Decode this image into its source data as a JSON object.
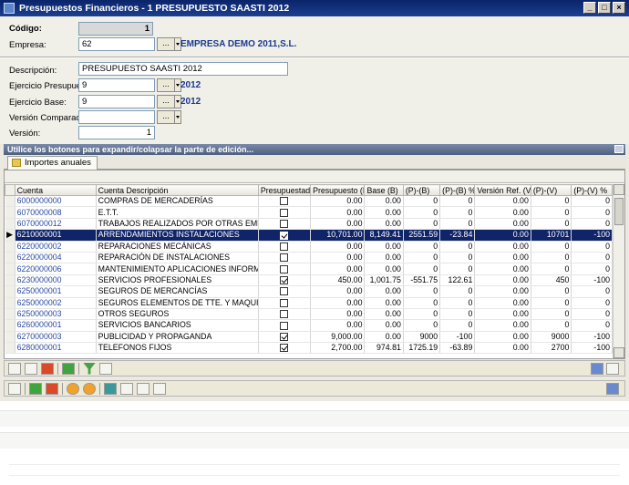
{
  "window": {
    "title": "Presupuestos Financieros - 1  PRESUPUESTO SAASTI 2012",
    "btn_min": "_",
    "btn_max": "□",
    "btn_close": "×"
  },
  "form": {
    "codigo_label": "Código:",
    "codigo_value": "1",
    "empresa_label": "Empresa:",
    "empresa_value": "62",
    "empresa_name": "EMPRESA DEMO 2011,S.L.",
    "descripcion_label": "Descripción:",
    "descripcion_value": "PRESUPUESTO SAASTI 2012",
    "ejercicio_presupuesto_label": "Ejercicio Presupuesto:",
    "ejercicio_presupuesto_value": "9",
    "ejercicio_presupuesto_year": "2012",
    "ejercicio_base_label": "Ejercicio Base:",
    "ejercicio_base_value": "9",
    "ejercicio_base_year": "2012",
    "version_comparacion_label": "Versión Comparación:",
    "version_comparacion_value": "",
    "version_label": "Versión:",
    "version_value": "1",
    "lookup_label": "..."
  },
  "collapse_bar": {
    "text": "Utilice los botones para expandir/colapsar la parte de edición..."
  },
  "tabs": [
    {
      "label": "Importes anuales"
    }
  ],
  "grid": {
    "columns": [
      "Cuenta",
      "Cuenta Descripción",
      "Presupuestada",
      "Presupuesto (P)",
      "Base (B)",
      "(P)-(B)",
      "(P)-(B) %",
      "Versión Ref. (V)",
      "(P)-(V)",
      "(P)-(V) %"
    ],
    "rows": [
      {
        "cuenta": "6000000000",
        "desc": "COMPRAS DE MERCADERÍAS",
        "pres": false,
        "p": "0.00",
        "b": "0.00",
        "pb": "0",
        "pbp": "0",
        "v": "0.00",
        "pv": "0",
        "pvp": "0"
      },
      {
        "cuenta": "6070000008",
        "desc": "E.T.T.",
        "pres": false,
        "p": "0.00",
        "b": "0.00",
        "pb": "0",
        "pbp": "0",
        "v": "0.00",
        "pv": "0",
        "pvp": "0"
      },
      {
        "cuenta": "6070000012",
        "desc": "TRABAJOS REALIZADOS POR OTRAS EMPRESA",
        "pres": false,
        "p": "0.00",
        "b": "0.00",
        "pb": "0",
        "pbp": "0",
        "v": "0.00",
        "pv": "0",
        "pvp": "0"
      },
      {
        "cuenta": "6210000001",
        "desc": "ARRENDAMIENTOS INSTALACIONES",
        "pres": true,
        "p": "10,701.00",
        "b": "8,149.41",
        "pb": "2551.59",
        "pbp": "-23.84",
        "v": "0.00",
        "pv": "10701",
        "pvp": "-100",
        "selected": true
      },
      {
        "cuenta": "6220000002",
        "desc": "REPARACIONES MECÁNICAS",
        "pres": false,
        "p": "0.00",
        "b": "0.00",
        "pb": "0",
        "pbp": "0",
        "v": "0.00",
        "pv": "0",
        "pvp": "0"
      },
      {
        "cuenta": "6220000004",
        "desc": "REPARACIÓN DE INSTALACIONES",
        "pres": false,
        "p": "0.00",
        "b": "0.00",
        "pb": "0",
        "pbp": "0",
        "v": "0.00",
        "pv": "0",
        "pvp": "0"
      },
      {
        "cuenta": "6220000006",
        "desc": "MANTENIMIENTO APLICACIONES INFORMÁTICA",
        "pres": false,
        "p": "0.00",
        "b": "0.00",
        "pb": "0",
        "pbp": "0",
        "v": "0.00",
        "pv": "0",
        "pvp": "0"
      },
      {
        "cuenta": "6230000000",
        "desc": "SERVICIOS PROFESIONALES",
        "pres": true,
        "p": "450.00",
        "b": "1,001.75",
        "pb": "-551.75",
        "pbp": "122.61",
        "v": "0.00",
        "pv": "450",
        "pvp": "-100"
      },
      {
        "cuenta": "6250000001",
        "desc": "SEGUROS DE MERCANCÍAS",
        "pres": false,
        "p": "0.00",
        "b": "0.00",
        "pb": "0",
        "pbp": "0",
        "v": "0.00",
        "pv": "0",
        "pvp": "0"
      },
      {
        "cuenta": "6250000002",
        "desc": "SEGUROS ELEMENTOS DE TTE. Y MAQUINARI",
        "pres": false,
        "p": "0.00",
        "b": "0.00",
        "pb": "0",
        "pbp": "0",
        "v": "0.00",
        "pv": "0",
        "pvp": "0"
      },
      {
        "cuenta": "6250000003",
        "desc": "OTROS SEGUROS",
        "pres": false,
        "p": "0.00",
        "b": "0.00",
        "pb": "0",
        "pbp": "0",
        "v": "0.00",
        "pv": "0",
        "pvp": "0"
      },
      {
        "cuenta": "6260000001",
        "desc": "SERVICIOS BANCARIOS",
        "pres": false,
        "p": "0.00",
        "b": "0.00",
        "pb": "0",
        "pbp": "0",
        "v": "0.00",
        "pv": "0",
        "pvp": "0"
      },
      {
        "cuenta": "6270000003",
        "desc": "PUBLICIDAD Y PROPAGANDA",
        "pres": true,
        "p": "9,000.00",
        "b": "0.00",
        "pb": "9000",
        "pbp": "-100",
        "v": "0.00",
        "pv": "9000",
        "pvp": "-100"
      },
      {
        "cuenta": "6280000001",
        "desc": "TELEFONOS FIJOS",
        "pres": true,
        "p": "2,700.00",
        "b": "974.81",
        "pb": "1725.19",
        "pbp": "-63.89",
        "v": "0.00",
        "pv": "2700",
        "pvp": "-100"
      }
    ]
  }
}
